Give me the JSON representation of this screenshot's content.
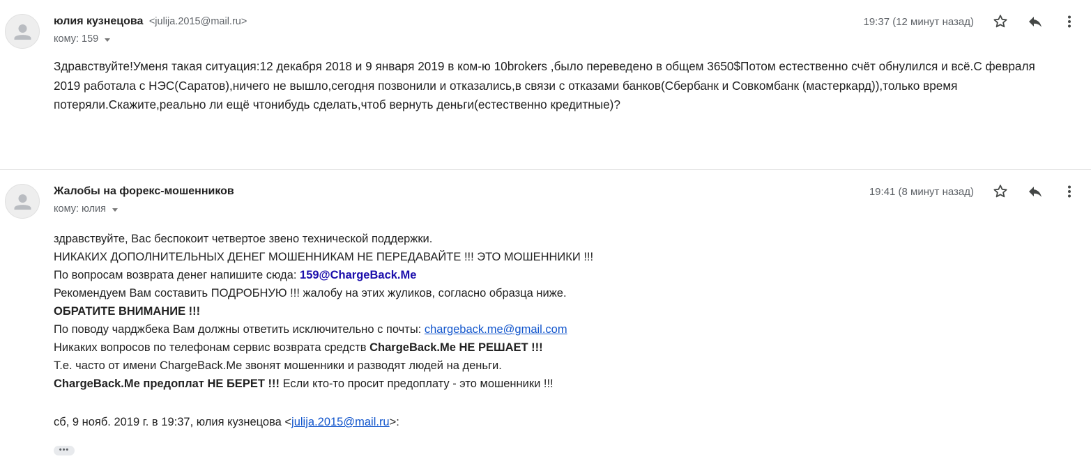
{
  "message1": {
    "sender_name": "юлия кузнецова",
    "sender_email": "<julija.2015@mail.ru>",
    "recipient": "кому: 159",
    "timestamp": "19:37 (12 минут назад)",
    "body": "Здравствуйте!Уменя такая ситуация:12  декабря 2018 и 9 января 2019 в ком-ю 10brokers ,было переведено в общем 3650$Потом естественно счёт обнулился и всё.С февраля 2019 работала с НЭС(Саратов),ничего не вышло,сегодня позвонили и отказались,в связи с отказами банков(Сбербанк и Совкомбанк (мастеркард)),только время потеряли.Скажите,реально ли ещё чтонибудь сделать,чтоб вернуть деньги(естественно кредитные)?"
  },
  "message2": {
    "sender_name": "Жалобы на форекс-мошенников",
    "recipient": "кому: юлия",
    "timestamp": "19:41 (8 минут назад)",
    "lines": {
      "l1": "здравствуйте, Вас беспокоит четвертое звено технической поддержки.",
      "l2": "НИКАКИХ ДОПОЛНИТЕЛЬНЫХ ДЕНЕГ МОШЕННИКАМ НЕ ПЕРЕДАВАЙТЕ !!! ЭТО МОШЕННИКИ !!!",
      "l3_prefix": "По вопросам возврата денег напишите сюда: ",
      "l3_email": "159@ChargeBack.Me",
      "l4": "Рекомендуем Вам составить ПОДРОБНУЮ !!! жалобу на этих жуликов, согласно образца ниже.",
      "l5": "ОБРАТИТЕ ВНИМАНИЕ !!!",
      "l6_prefix": "По поводу чарджбека Вам должны ответить исключительно с почты: ",
      "l6_email": "chargeback.me@gmail.com",
      "l7_prefix": "Никаких вопросов по телефонам сервис возврата средств ",
      "l7_bold": "ChargeBack.Me НЕ РЕШАЕТ !!!",
      "l8": "Т.е. часто от имени ChargeBack.Me звонят мошенники и разводят людей на деньги.",
      "l9_bold": "ChargeBack.Me предоплат НЕ БЕРЕТ !!!",
      "l9_suffix": " Если кто-то просит предоплату - это мошенники !!!"
    },
    "quote_header_prefix": "сб, 9 нояб. 2019 г. в 19:37, юлия кузнецова <",
    "quote_header_email": "julija.2015@mail.ru",
    "quote_header_suffix": ">:",
    "ellipsis": "•••"
  },
  "icons": [
    "avatar-icon",
    "star-icon",
    "reply-icon",
    "more-vert-icon",
    "chevron-down-icon"
  ],
  "colors": {
    "link_blue": "#1155cc",
    "bold_blue": "#1a0dab",
    "muted_gray": "#5f6368",
    "text": "#222222",
    "divider": "#e5e5e5"
  }
}
